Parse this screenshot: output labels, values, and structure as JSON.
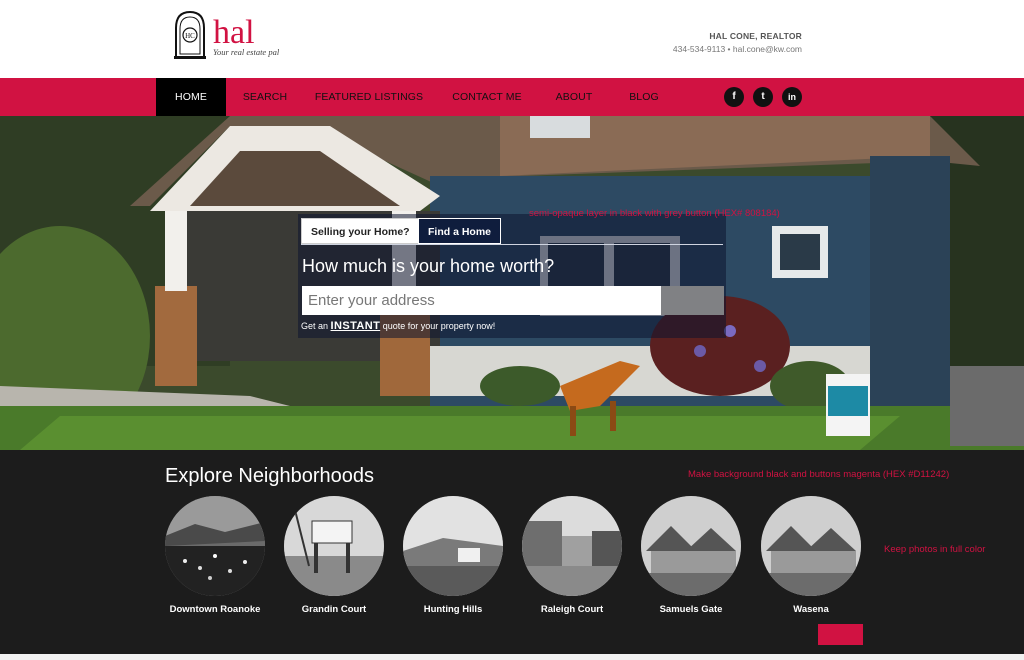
{
  "brand": {
    "name": "hal",
    "tagline": "Your real estate pal",
    "seal_monogram": "HC",
    "accent_color": "#D11242"
  },
  "contact": {
    "name": "HAL CONE, REALTOR",
    "details": "434-534-9113 • hal.cone@kw.com"
  },
  "nav": {
    "items": [
      {
        "label": "HOME",
        "active": true
      },
      {
        "label": "SEARCH"
      },
      {
        "label": "FEATURED LISTINGS"
      },
      {
        "label": "CONTACT ME"
      },
      {
        "label": "ABOUT"
      },
      {
        "label": "BLOG"
      }
    ],
    "social": [
      {
        "icon": "facebook-icon",
        "glyph": "f"
      },
      {
        "icon": "twitter-icon",
        "glyph": "t"
      },
      {
        "icon": "linkedin-icon",
        "glyph": "in"
      }
    ]
  },
  "hero": {
    "tabs": [
      {
        "label": "Selling your Home?",
        "active": true
      },
      {
        "label": "Find a Home"
      }
    ],
    "question": "How much is your home worth?",
    "address_placeholder": "Enter your address",
    "quote_prefix": "Get an",
    "quote_emphasis": "INSTANT",
    "quote_suffix": "quote for your property now!",
    "overlay_button_color": "#808184"
  },
  "annotations": {
    "overlay_note": "semi-opaque layer in black with grey button (HEX# 808184)",
    "background_note": "Make background black and buttons magenta (HEX #D11242)",
    "photos_note": "Keep photos in full color"
  },
  "neighborhoods": {
    "title": "Explore Neighborhoods",
    "items": [
      {
        "label": "Downtown Roanoke"
      },
      {
        "label": "Grandin Court"
      },
      {
        "label": "Hunting Hills"
      },
      {
        "label": "Raleigh Court"
      },
      {
        "label": "Samuels Gate"
      },
      {
        "label": "Wasena"
      }
    ]
  }
}
